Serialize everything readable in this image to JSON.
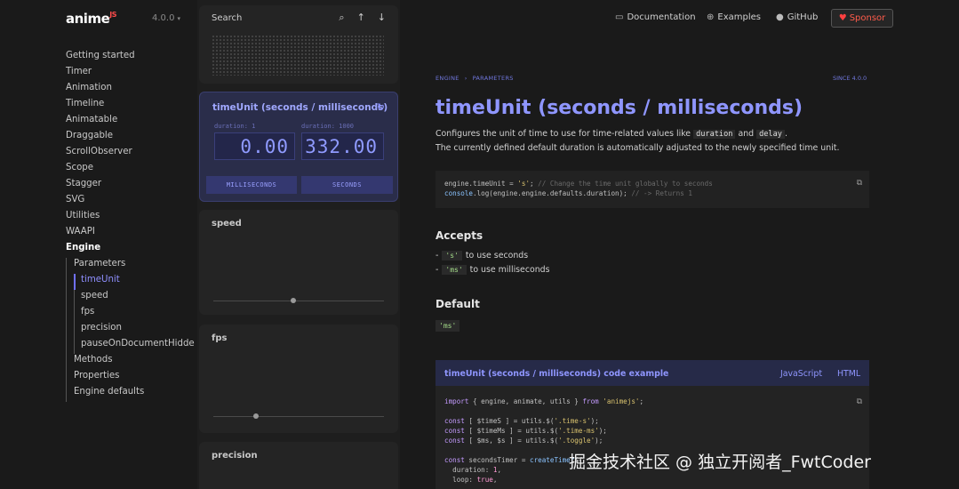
{
  "brand": {
    "logo": "anime",
    "logo_suffix": "JS",
    "version": "4.0.0"
  },
  "sidebar": {
    "items": [
      "Getting started",
      "Timer",
      "Animation",
      "Timeline",
      "Animatable",
      "Draggable",
      "ScrollObserver",
      "Scope",
      "Stagger",
      "SVG",
      "Utilities",
      "WAAPI"
    ],
    "engine_label": "Engine",
    "parameters_label": "Parameters",
    "parameters": [
      "timeUnit",
      "speed",
      "fps",
      "precision",
      "pauseOnDocumentHidde"
    ],
    "after_parameters": [
      "Methods",
      "Properties",
      "Engine defaults"
    ]
  },
  "demo": {
    "search_label": "Search",
    "timeunit_title": "timeUnit (seconds / milliseconds)",
    "duration_s_label": "duration: 1",
    "duration_ms_label": "duration: 1000",
    "duration_s_value": "0.00",
    "duration_ms_value": "332.00",
    "btn_ms": "MILLISECONDS",
    "btn_s": "SECONDS",
    "speed_label": "speed",
    "fps_label": "fps",
    "precision_label": "precision",
    "speed_slider_value": 0.47,
    "fps_slider_value": 0.25
  },
  "topbar": {
    "documentation": "Documentation",
    "examples": "Examples",
    "github": "GitHub",
    "sponsor": "Sponsor"
  },
  "article": {
    "crumb1": "ENGINE",
    "crumb2": "PARAMETERS",
    "since": "SINCE 4.0.0",
    "title": "timeUnit (seconds / milliseconds)",
    "desc_pre": "Configures the unit of time to use for time-related values like",
    "desc_code1": "duration",
    "desc_and": "and",
    "desc_code2": "delay",
    "desc_line2": "The currently defined default duration is automatically adjusted to the newly specified time unit.",
    "accepts_heading": "Accepts",
    "accepts": [
      {
        "code": "'s'",
        "text": "to use seconds"
      },
      {
        "code": "'ms'",
        "text": "to use milliseconds"
      }
    ],
    "default_heading": "Default",
    "default_value": "'ms'",
    "example_title": "timeUnit (seconds / milliseconds) code example",
    "tab_js": "JavaScript",
    "tab_html": "HTML"
  },
  "watermark": "掘金技术社区 @ 独立开阅者_FwtCoder"
}
